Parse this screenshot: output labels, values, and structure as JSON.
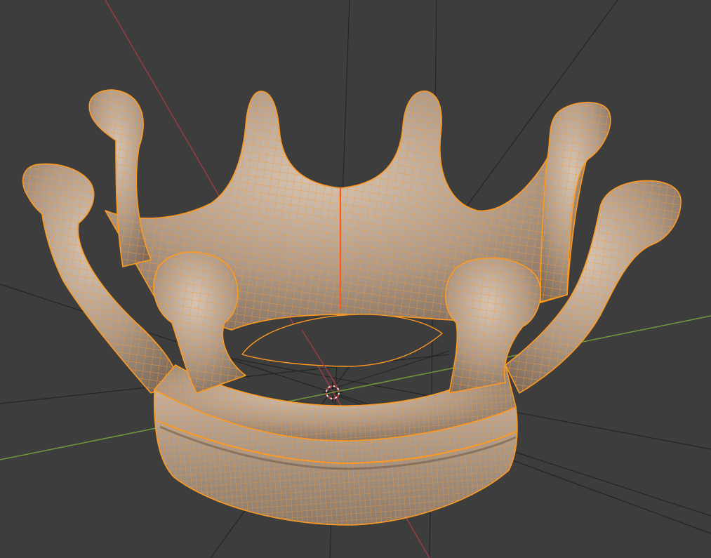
{
  "viewport": {
    "background": "#3d3d3d",
    "grid_color": "#262626",
    "x_axis_color": "#9b3b45",
    "y_axis_color": "#6f9a3a",
    "selection_outline": "#ff9a1f",
    "wire_color": "#f09a3a",
    "mesh_shade_light": "#d2bfae",
    "mesh_shade_base": "#a58f7c",
    "mesh_shade_dark": "#7a6656",
    "seam_color": "#ff5a14"
  },
  "scene": {
    "object": "crown-mesh",
    "mode": "edit-mode-selected",
    "icons": [
      "3d-cursor-icon"
    ]
  }
}
